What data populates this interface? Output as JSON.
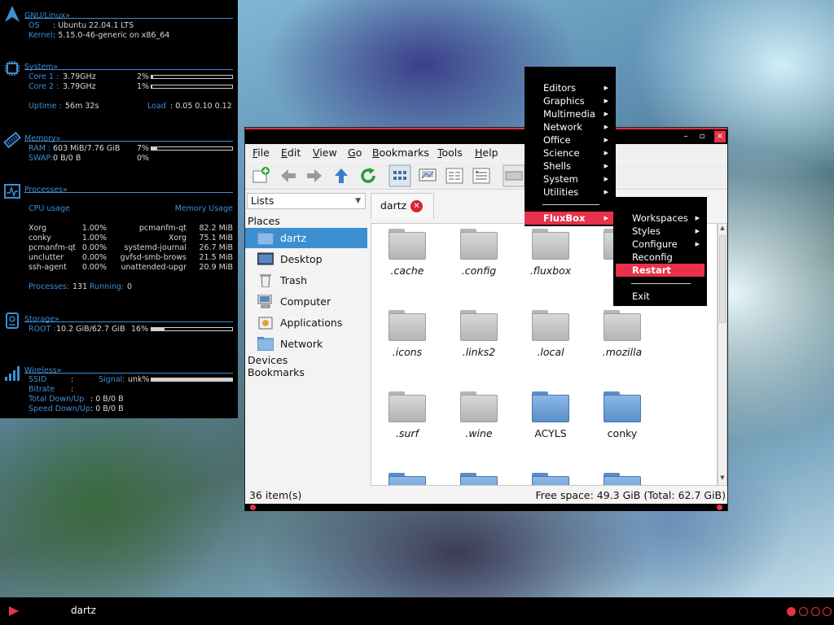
{
  "conky": {
    "gnu": {
      "title": "GNU/Linux»",
      "os_label": "OS",
      "os_value": ": Ubuntu 22.04.1 LTS",
      "kernel_label": "Kernel",
      "kernel_value": ": 5.15.0-46-generic on x86_64"
    },
    "system": {
      "title": "System»",
      "cores": [
        {
          "label": "Core 1 :",
          "freq": "3.79GHz",
          "pct": "2%",
          "level": 0.02
        },
        {
          "label": "Core 2 :",
          "freq": "3.79GHz",
          "pct": "1%",
          "level": 0.01
        }
      ],
      "uptime_label": "Uptime :",
      "uptime_value": "56m 32s",
      "load_label": "Load",
      "load_value": ": 0.05 0.10 0.12"
    },
    "memory": {
      "title": "Memory»",
      "ram_label": "RAM :",
      "ram_value": "603 MiB/7.76 GiB",
      "ram_pct": "7%",
      "ram_level": 0.07,
      "swap_label": "SWAP:",
      "swap_value": "0 B/0 B",
      "swap_pct": "0%"
    },
    "processes": {
      "title": "Processes»",
      "cpu_header": "CPU usage",
      "mem_header": "Memory Usage",
      "rows": [
        {
          "name": "Xorg",
          "cpu": "1.00%",
          "mname": "pcmanfm-qt",
          "mem": "82.2 MiB"
        },
        {
          "name": "conky",
          "cpu": "1.00%",
          "mname": "Xorg",
          "mem": "75.1 MiB"
        },
        {
          "name": "pcmanfm-qt",
          "cpu": "0.00%",
          "mname": "systemd-journal",
          "mem": "26.7 MiB"
        },
        {
          "name": "unclutter",
          "cpu": "0.00%",
          "mname": "gvfsd-smb-brows",
          "mem": "21.5 MiB"
        },
        {
          "name": "ssh-agent",
          "cpu": "0.00%",
          "mname": "unattended-upgr",
          "mem": "20.9 MiB"
        }
      ],
      "summary_label": "Processes:",
      "summary_count": "131",
      "running_label": "Running:",
      "running_count": "0"
    },
    "storage": {
      "title": "Storage»",
      "root_label": "ROOT :",
      "root_value": "10.2 GiB/62.7 GiB",
      "root_pct": "16%",
      "root_level": 0.16
    },
    "wireless": {
      "title": "Wireless»",
      "ssid_label": "SSID",
      "ssid_value": ":",
      "signal_label": "Signal:",
      "signal_value": "unk%",
      "bitrate_label": "Bitrate",
      "bitrate_value": ":",
      "total_label": "Total Down/Up",
      "total_value": ": 0 B/0 B",
      "speed_label": "Speed Down/Up",
      "speed_value": ": 0 B/0 B"
    }
  },
  "filemanager": {
    "menu": [
      "File",
      "Edit",
      "View",
      "Go",
      "Bookmarks",
      "Tools",
      "Help"
    ],
    "side_combo": "Lists",
    "places_header": "Places",
    "places": [
      "dartz",
      "Desktop",
      "Trash",
      "Computer",
      "Applications",
      "Network"
    ],
    "devices_header": "Devices",
    "bookmarks_header": "Bookmarks",
    "tab_label": "dartz",
    "files": [
      {
        "name": ".cache",
        "kind": "gray"
      },
      {
        "name": ".config",
        "kind": "gray"
      },
      {
        "name": ".fluxbox",
        "kind": "gray"
      },
      {
        "name": ".g",
        "kind": "gray"
      },
      {
        "name": ".icons",
        "kind": "gray"
      },
      {
        "name": ".links2",
        "kind": "gray"
      },
      {
        "name": ".local",
        "kind": "gray"
      },
      {
        "name": ".mozilla",
        "kind": "gray"
      },
      {
        "name": ".surf",
        "kind": "gray"
      },
      {
        "name": ".wine",
        "kind": "gray"
      },
      {
        "name": "ACYLS",
        "kind": "blue"
      },
      {
        "name": "conky",
        "kind": "blue"
      }
    ],
    "status_items": "36 item(s)",
    "status_space": "Free space: 49.3 GiB (Total: 62.7 GiB)",
    "colors": {
      "accent": "#e8314a",
      "selection": "#3b8fd0",
      "conky_text": "#3d8fd6"
    }
  },
  "rootmenu": {
    "items": [
      "Editors",
      "Graphics",
      "Multimedia",
      "Network",
      "Office",
      "Science",
      "Shells",
      "System",
      "Utilities"
    ],
    "fluxbox": "FluxBox"
  },
  "fluxboxmenu": {
    "items": [
      "Workspaces",
      "Styles",
      "Configure",
      "Reconfig",
      "Restart",
      "Exit"
    ]
  },
  "taskbar": {
    "task": "dartz"
  }
}
